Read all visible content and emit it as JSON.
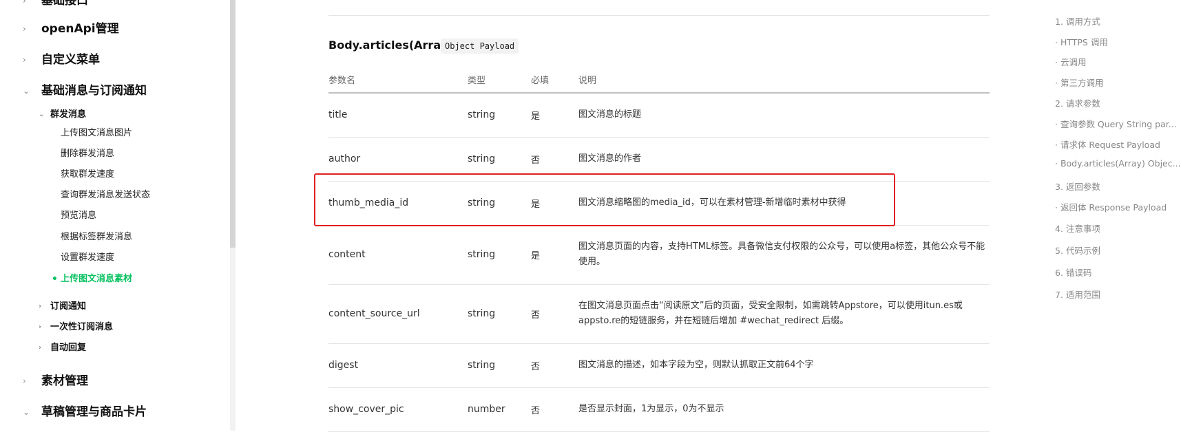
{
  "sidebar": {
    "top_partial": "基础接口",
    "groups": [
      {
        "label": "openApi管理",
        "chevron": "chevron-right-icon"
      },
      {
        "label": "自定义菜单",
        "chevron": "chevron-right-icon"
      },
      {
        "label": "基础消息与订阅通知",
        "chevron": "chevron-down-icon"
      }
    ],
    "subgroup_mass": "群发消息",
    "mass_items": [
      "上传图文消息图片",
      "删除群发消息",
      "获取群发速度",
      "查询群发消息发送状态",
      "预览消息",
      "根据标签群发消息",
      "设置群发速度",
      "上传图文消息素材"
    ],
    "active_item": "上传图文消息素材",
    "subgroups_after": [
      "订阅通知",
      "一次性订阅消息",
      "自动回复"
    ],
    "groups_after": [
      {
        "label": "素材管理",
        "chevron": "chevron-right-icon"
      },
      {
        "label": "草稿管理与商品卡片",
        "chevron": "chevron-down-icon"
      }
    ]
  },
  "section": {
    "title": "Body.articles(Array)",
    "tag": "Object Payload"
  },
  "table": {
    "headers": [
      "参数名",
      "类型",
      "必填",
      "说明"
    ],
    "rows": [
      {
        "name": "title",
        "type": "string",
        "required": "是",
        "desc": "图文消息的标题"
      },
      {
        "name": "author",
        "type": "string",
        "required": "否",
        "desc": "图文消息的作者"
      },
      {
        "name": "thumb_media_id",
        "type": "string",
        "required": "是",
        "desc": "图文消息缩略图的media_id，可以在素材管理-新增临时素材中获得"
      },
      {
        "name": "content",
        "type": "string",
        "required": "是",
        "desc": "图文消息页面的内容，支持HTML标签。具备微信支付权限的公众号，可以使用a标签，其他公众号不能使用。"
      },
      {
        "name": "content_source_url",
        "type": "string",
        "required": "否",
        "desc": "在图文消息页面点击“阅读原文”后的页面，受安全限制，如需跳转Appstore，可以使用itun.es或appsto.re的短链服务，并在短链后增加 #wechat_redirect 后缀。"
      },
      {
        "name": "digest",
        "type": "string",
        "required": "否",
        "desc": "图文消息的描述，如本字段为空，则默认抓取正文前64个字"
      },
      {
        "name": "show_cover_pic",
        "type": "number",
        "required": "否",
        "desc": "是否显示封面，1为显示，0为不显示"
      }
    ]
  },
  "toc": [
    "1. 调用方式",
    "· HTTPS 调用",
    "· 云调用",
    "· 第三方调用",
    "2. 请求参数",
    "· 查询参数 Query String par...",
    "· 请求体 Request Payload",
    "· Body.articles(Array) Objec...",
    "3. 返回参数",
    "· 返回体 Response Payload",
    "4. 注意事项",
    "5. 代码示例",
    "6. 错误码",
    "7. 适用范围"
  ],
  "colors": {
    "accent": "#07c160",
    "highlight": "#e02020"
  }
}
